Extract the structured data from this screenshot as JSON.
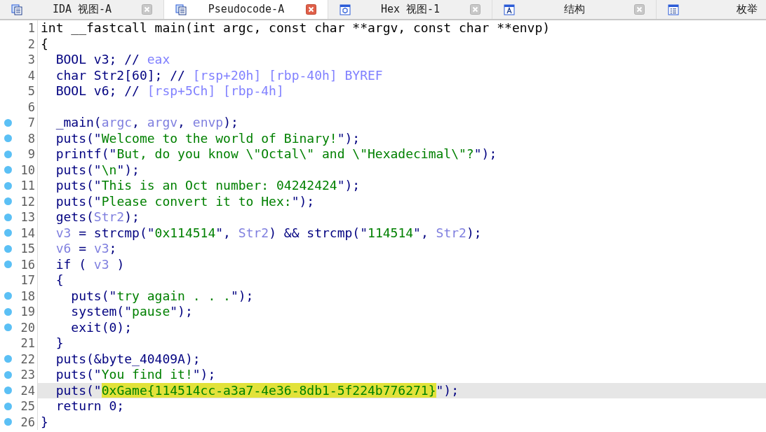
{
  "tabs": [
    {
      "label": "IDA 视图-A",
      "kind": "document",
      "selected": false,
      "closable": true
    },
    {
      "label": "Pseudocode-A",
      "kind": "document",
      "selected": true,
      "closable": true
    },
    {
      "label": "Hex 视图-1",
      "kind": "hexagon",
      "selected": false,
      "closable": true
    },
    {
      "label": "结构",
      "kind": "structure",
      "selected": false,
      "closable": true
    },
    {
      "label": "枚举",
      "kind": "list",
      "selected": false,
      "closable": false
    }
  ],
  "code_lines": [
    {
      "number": "1",
      "breakpoint": false,
      "selected": false,
      "tokens": [
        {
          "kind": "header",
          "text": "int __fastcall main(int argc, const char **argv, const char **envp)"
        }
      ]
    },
    {
      "number": "2",
      "breakpoint": false,
      "selected": false,
      "tokens": [
        {
          "kind": "header",
          "text": "{"
        }
      ]
    },
    {
      "number": "3",
      "breakpoint": false,
      "selected": false,
      "tokens": [
        {
          "kind": "plain",
          "text": "  BOOL v3; // "
        },
        {
          "kind": "comment",
          "text": "eax"
        }
      ]
    },
    {
      "number": "4",
      "breakpoint": false,
      "selected": false,
      "tokens": [
        {
          "kind": "plain",
          "text": "  char Str2[60]; // "
        },
        {
          "kind": "comment",
          "text": "[rsp+20h] [rbp-40h] BYREF"
        }
      ]
    },
    {
      "number": "5",
      "breakpoint": false,
      "selected": false,
      "tokens": [
        {
          "kind": "plain",
          "text": "  BOOL v6; // "
        },
        {
          "kind": "comment",
          "text": "[rsp+5Ch] [rbp-4h]"
        }
      ]
    },
    {
      "number": "6",
      "breakpoint": false,
      "selected": false
    },
    {
      "number": "7",
      "breakpoint": true,
      "selected": false,
      "tokens": [
        {
          "kind": "plain",
          "text": "  _main("
        },
        {
          "kind": "variable",
          "text": "argc"
        },
        {
          "kind": "plain",
          "text": ", "
        },
        {
          "kind": "variable",
          "text": "argv"
        },
        {
          "kind": "plain",
          "text": ", "
        },
        {
          "kind": "variable",
          "text": "envp"
        },
        {
          "kind": "plain",
          "text": ");"
        }
      ]
    },
    {
      "number": "8",
      "breakpoint": true,
      "selected": false,
      "tokens": [
        {
          "kind": "plain",
          "text": "  puts(\""
        },
        {
          "kind": "string",
          "text": "Welcome to the world of Binary!"
        },
        {
          "kind": "plain",
          "text": "\");"
        }
      ]
    },
    {
      "number": "9",
      "breakpoint": true,
      "selected": false,
      "tokens": [
        {
          "kind": "plain",
          "text": "  printf(\""
        },
        {
          "kind": "string",
          "text": "But, do you know \\\"Octal\\\" and \\\"Hexadecimal\\\"?"
        },
        {
          "kind": "plain",
          "text": "\");"
        }
      ]
    },
    {
      "number": "10",
      "breakpoint": true,
      "selected": false,
      "tokens": [
        {
          "kind": "plain",
          "text": "  puts(\""
        },
        {
          "kind": "string",
          "text": "\\n"
        },
        {
          "kind": "plain",
          "text": "\");"
        }
      ]
    },
    {
      "number": "11",
      "breakpoint": true,
      "selected": false,
      "tokens": [
        {
          "kind": "plain",
          "text": "  puts(\""
        },
        {
          "kind": "string",
          "text": "This is an Oct number: 04242424"
        },
        {
          "kind": "plain",
          "text": "\");"
        }
      ]
    },
    {
      "number": "12",
      "breakpoint": true,
      "selected": false,
      "tokens": [
        {
          "kind": "plain",
          "text": "  puts(\""
        },
        {
          "kind": "string",
          "text": "Please convert it to Hex:"
        },
        {
          "kind": "plain",
          "text": "\");"
        }
      ]
    },
    {
      "number": "13",
      "breakpoint": true,
      "selected": false,
      "tokens": [
        {
          "kind": "plain",
          "text": "  gets("
        },
        {
          "kind": "variable",
          "text": "Str2"
        },
        {
          "kind": "plain",
          "text": ");"
        }
      ]
    },
    {
      "number": "14",
      "breakpoint": true,
      "selected": false,
      "tokens": [
        {
          "kind": "variable",
          "text": "  v3"
        },
        {
          "kind": "plain",
          "text": " = strcmp(\""
        },
        {
          "kind": "string",
          "text": "0x114514"
        },
        {
          "kind": "plain",
          "text": "\", "
        },
        {
          "kind": "variable",
          "text": "Str2"
        },
        {
          "kind": "plain",
          "text": ") && strcmp(\""
        },
        {
          "kind": "string",
          "text": "114514"
        },
        {
          "kind": "plain",
          "text": "\", "
        },
        {
          "kind": "variable",
          "text": "Str2"
        },
        {
          "kind": "plain",
          "text": ");"
        }
      ]
    },
    {
      "number": "15",
      "breakpoint": true,
      "selected": false,
      "tokens": [
        {
          "kind": "variable",
          "text": "  v6"
        },
        {
          "kind": "plain",
          "text": " = "
        },
        {
          "kind": "variable",
          "text": "v3"
        },
        {
          "kind": "plain",
          "text": ";"
        }
      ]
    },
    {
      "number": "16",
      "breakpoint": true,
      "selected": false,
      "tokens": [
        {
          "kind": "plain",
          "text": "  if ( "
        },
        {
          "kind": "variable",
          "text": "v3"
        },
        {
          "kind": "plain",
          "text": " )"
        }
      ]
    },
    {
      "number": "17",
      "breakpoint": false,
      "selected": false,
      "tokens": [
        {
          "kind": "plain",
          "text": "  {"
        }
      ]
    },
    {
      "number": "18",
      "breakpoint": true,
      "selected": false,
      "tokens": [
        {
          "kind": "plain",
          "text": "    puts(\""
        },
        {
          "kind": "string",
          "text": "try again . . ."
        },
        {
          "kind": "plain",
          "text": "\");"
        }
      ]
    },
    {
      "number": "19",
      "breakpoint": true,
      "selected": false,
      "tokens": [
        {
          "kind": "plain",
          "text": "    system(\""
        },
        {
          "kind": "string",
          "text": "pause"
        },
        {
          "kind": "plain",
          "text": "\");"
        }
      ]
    },
    {
      "number": "20",
      "breakpoint": true,
      "selected": false,
      "tokens": [
        {
          "kind": "plain",
          "text": "    exit(0);"
        }
      ]
    },
    {
      "number": "21",
      "breakpoint": false,
      "selected": false,
      "tokens": [
        {
          "kind": "plain",
          "text": "  }"
        }
      ]
    },
    {
      "number": "22",
      "breakpoint": true,
      "selected": false,
      "tokens": [
        {
          "kind": "plain",
          "text": "  puts(&byte_40409A);"
        }
      ]
    },
    {
      "number": "23",
      "breakpoint": true,
      "selected": false,
      "tokens": [
        {
          "kind": "plain",
          "text": "  puts(\""
        },
        {
          "kind": "string",
          "text": "You find it!"
        },
        {
          "kind": "plain",
          "text": "\");"
        }
      ]
    },
    {
      "number": "24",
      "breakpoint": true,
      "selected": true,
      "tokens": [
        {
          "kind": "plain",
          "text": "  puts(\""
        },
        {
          "kind": "highlight",
          "text": "0xGame{114514cc-a3a7-4e36-8db1-5f224b776271}"
        },
        {
          "kind": "plain",
          "text": "\");"
        }
      ]
    },
    {
      "number": "25",
      "breakpoint": true,
      "selected": false,
      "tokens": [
        {
          "kind": "plain",
          "text": "  return 0;"
        }
      ]
    },
    {
      "number": "26",
      "breakpoint": true,
      "selected": false,
      "tokens": [
        {
          "kind": "plain",
          "text": "}"
        }
      ]
    }
  ]
}
